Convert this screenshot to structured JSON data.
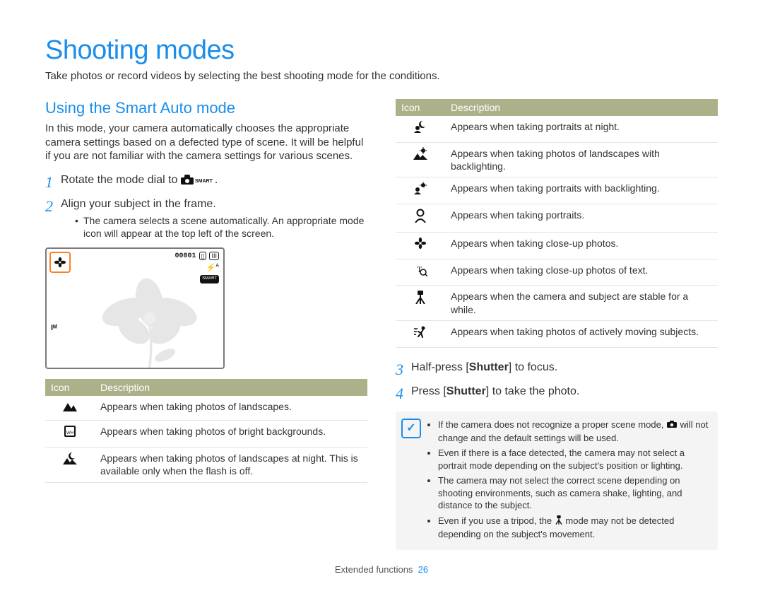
{
  "title": "Shooting modes",
  "intro": "Take photos or record videos by selecting the best shooting mode for the conditions.",
  "section_heading": "Using the Smart Auto mode",
  "section_body": "In this mode, your camera automatically chooses the appropriate camera settings based on a defected type of scene. It will be helpful if you are not familiar with the camera settings for various scenes.",
  "steps": {
    "s1": {
      "num": "1",
      "text_before": "Rotate the mode dial to ",
      "text_after": "."
    },
    "s2": {
      "num": "2",
      "text": "Align your subject in the frame.",
      "bullet": "The camera selects a scene automatically. An appropriate mode icon will appear at the top left of the screen."
    },
    "s3": {
      "num": "3",
      "prefix": "Half-press [",
      "bold": "Shutter",
      "suffix": "] to focus."
    },
    "s4": {
      "num": "4",
      "prefix": "Press [",
      "bold": "Shutter",
      "suffix": "] to take the photo."
    }
  },
  "smart_label": "SMART",
  "lcd": {
    "counter": "00001",
    "batt_label": "III",
    "macro_icon": "✿",
    "md": "Iᴹ",
    "flash": "⚡ᴬ"
  },
  "table_headers": {
    "icon": "Icon",
    "desc": "Description"
  },
  "left_table": [
    {
      "icon": "▲",
      "svg": "mountain",
      "desc": "Appears when taking photos of landscapes."
    },
    {
      "icon": "■",
      "svg": "white-square",
      "desc": "Appears when taking photos of bright backgrounds."
    },
    {
      "icon": "☽",
      "svg": "moon-mountain",
      "desc": "Appears when taking photos of landscapes at night. This is available only when the flash is off."
    }
  ],
  "right_table": [
    {
      "icon": "☽",
      "svg": "moon-person",
      "desc": "Appears when taking portraits at night."
    },
    {
      "icon": "☀",
      "svg": "sun-mountain",
      "desc": "Appears when taking photos of landscapes with backlighting."
    },
    {
      "icon": "☀",
      "svg": "sun-person",
      "desc": "Appears when taking portraits with backlighting."
    },
    {
      "icon": "☺",
      "svg": "portrait",
      "desc": "Appears when taking portraits."
    },
    {
      "icon": "✿",
      "svg": "macro",
      "desc": "Appears when taking close-up photos."
    },
    {
      "icon": "T",
      "svg": "text-macro",
      "desc": "Appears when taking close-up photos of text."
    },
    {
      "icon": "⌖",
      "svg": "tripod",
      "desc": "Appears when the camera and subject are stable for a while."
    },
    {
      "icon": "≋",
      "svg": "action",
      "desc": "Appears when taking photos of actively moving subjects."
    }
  ],
  "notes": [
    {
      "pre": "If the camera does not recognize a proper scene mode, ",
      "icon": true,
      "post": " will not change and the default settings will be used."
    },
    {
      "pre": "Even if there is a face detected, the camera may not select a portrait mode depending on the subject's position or lighting.",
      "icon": false,
      "post": ""
    },
    {
      "pre": "The camera may not select the correct scene depending on shooting environments, such as camera shake, lighting, and distance to the subject.",
      "icon": false,
      "post": ""
    },
    {
      "pre": "Even if you use a tripod, the ",
      "icon": true,
      "icon_name": "tripod",
      "post": " mode may not be detected depending on the subject's movement."
    }
  ],
  "footer": {
    "label": "Extended functions",
    "page": "26"
  }
}
